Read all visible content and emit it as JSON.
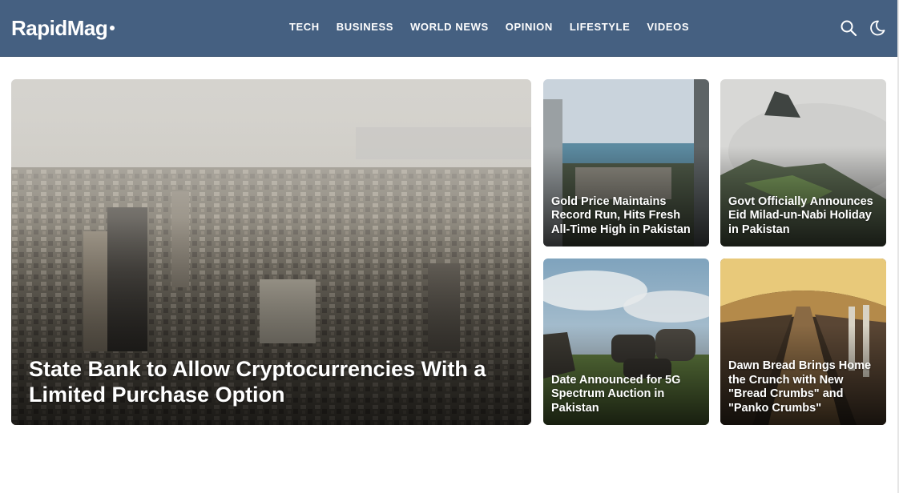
{
  "site": {
    "logo": "RapidMag"
  },
  "nav": [
    "TECH",
    "BUSINESS",
    "WORLD NEWS",
    "OPINION",
    "LIFESTYLE",
    "VIDEOS"
  ],
  "icons": {
    "search": "search-icon",
    "theme": "moon-icon"
  },
  "colors": {
    "header": "#456081",
    "text": "#ffffff"
  },
  "featured": {
    "title": "State Bank to Allow Cryptocurrencies With a Limited Purchase Option"
  },
  "articles": [
    {
      "title": "Gold Price Maintains Record Run, Hits Fresh All-Time High in Pakistan"
    },
    {
      "title": "Govt Officially Announces Eid Milad-un-Nabi Holiday in Pakistan"
    },
    {
      "title": "Date Announced for 5G Spectrum Auction in Pakistan"
    },
    {
      "title": "Dawn Bread Brings Home the Crunch with New \"Bread Crumbs\" and \"Panko Crumbs\""
    }
  ]
}
